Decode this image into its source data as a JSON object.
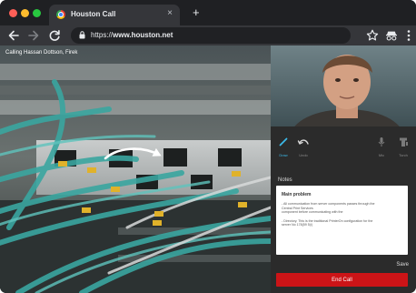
{
  "window": {
    "tab_title": "Houston Call",
    "tab_close": "×",
    "new_tab": "+",
    "url_prefix": "https://",
    "url_domain": "www.houston.net"
  },
  "call": {
    "caller_text": "Calling Hassan Dottson, Firek",
    "tools": [
      {
        "label": "Draw",
        "icon": "pen-icon",
        "active": true
      },
      {
        "label": "Undo",
        "icon": "undo-icon",
        "active": false
      },
      {
        "label": "Mic",
        "icon": "mic-icon",
        "active": false
      },
      {
        "label": "Torch",
        "icon": "torch-icon",
        "active": false
      }
    ]
  },
  "notes": {
    "title": "Notes",
    "heading": "Main problem",
    "lines": [
      "- All communication from server components passes through the",
      "Central Print Services",
      "component before communicating with the",
      "",
      "- Directory. This is the traditional PrinterOn configuration for the",
      "server No 178(59 5)/)"
    ],
    "save_label": "Save"
  },
  "end_call_label": "End Call",
  "colors": {
    "accent": "#3cb9e8",
    "end_call": "#cc1417",
    "chrome_dark": "#202124",
    "toolbar": "#35363a"
  }
}
